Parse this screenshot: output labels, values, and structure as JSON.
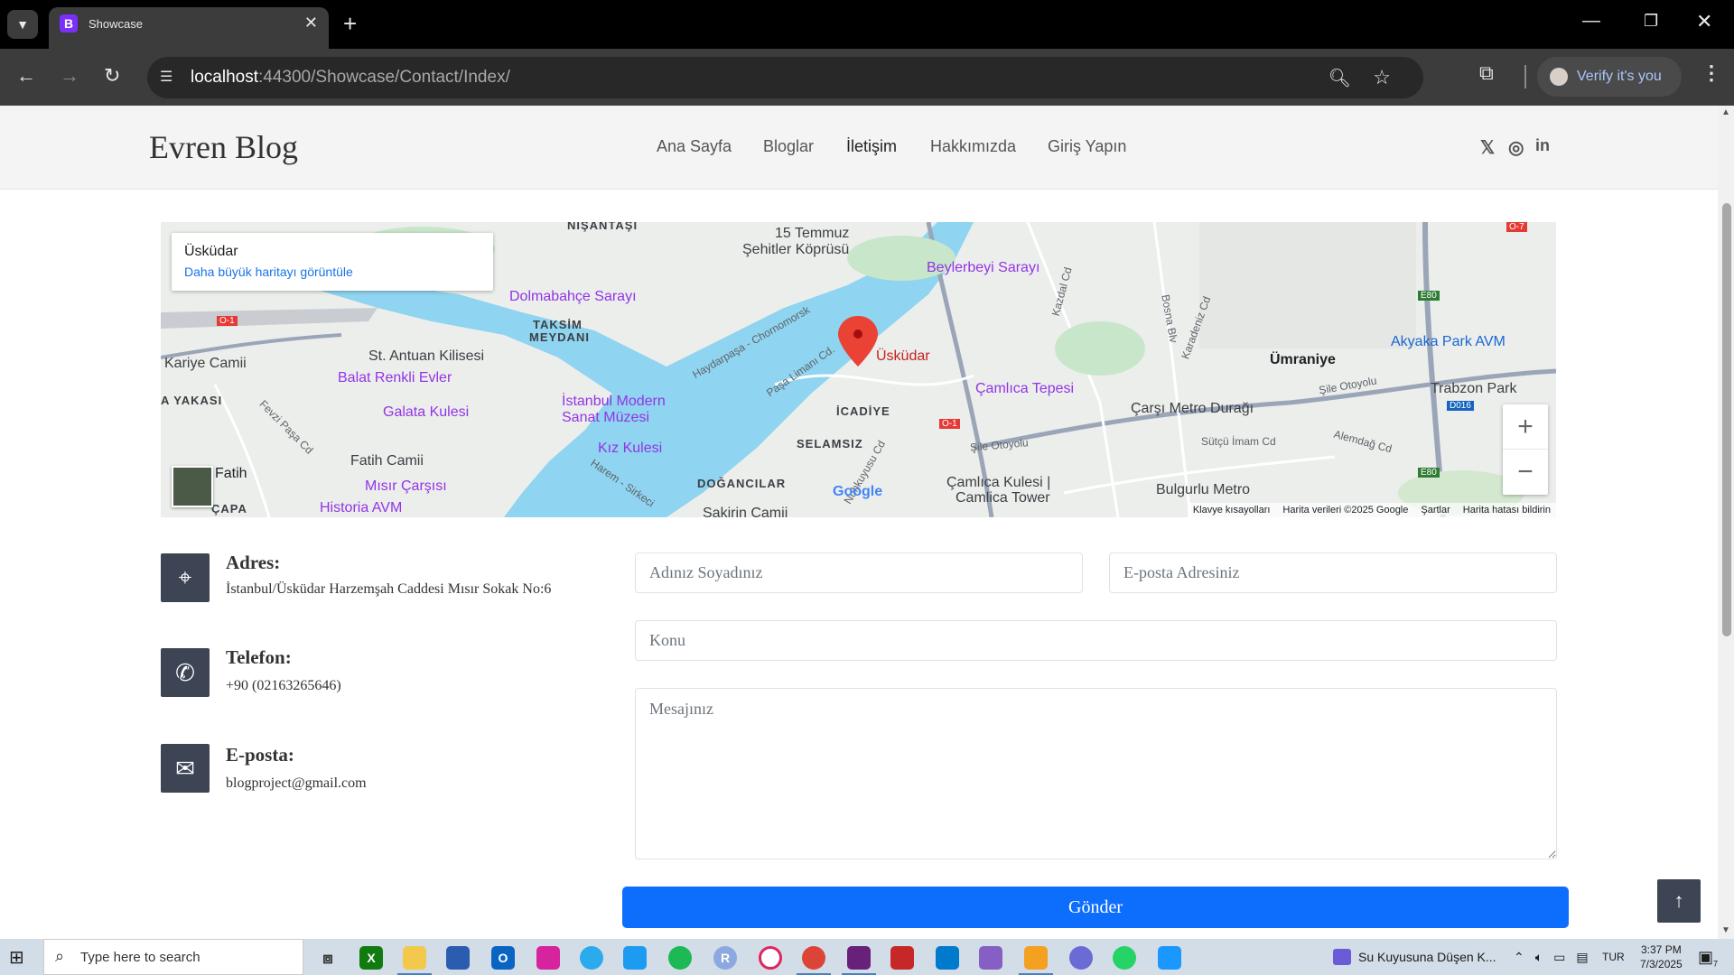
{
  "browser": {
    "tab_title": "Showcase",
    "tab_favicon_letter": "B",
    "url_host": "localhost",
    "url_path": ":44300/Showcase/Contact/Index/",
    "verify_label": "Verify it's you"
  },
  "site": {
    "brand": "Evren Blog",
    "nav": [
      {
        "label": "Ana Sayfa"
      },
      {
        "label": "Bloglar"
      },
      {
        "label": "İletişim"
      },
      {
        "label": "Hakkımızda"
      },
      {
        "label": "Giriş Yapın"
      }
    ],
    "active_nav": "İletişim",
    "social_icons": [
      "x-icon",
      "instagram-icon",
      "linkedin-icon"
    ]
  },
  "map": {
    "place_title": "Üsküdar",
    "bigger_map_link": "Daha büyük haritayı görüntüle",
    "marker_label": "Üsküdar",
    "labels": {
      "nisantasi": "NİŞANTAŞI",
      "temmuz": "15 Temmuz",
      "sehitler": "Şehitler Köprüsü",
      "beylerbeyi": "Beylerbeyi Sarayı",
      "dolmabahce": "Dolmabahçe Sarayı",
      "taksim1": "TAKSİM",
      "taksim2": "MEYDANI",
      "kariye": "Kariye Camii",
      "antuan": "St. Antuan Kilisesi",
      "balat": "Balat Renkli Evler",
      "galata": "Galata Kulesi",
      "modern1": "İstanbul Modern",
      "modern2": "Sanat Müzesi",
      "yakasi": "A YAKASI",
      "fevzi": "Fevzi Paşa Cd",
      "kiz": "Kız Kulesi",
      "fatih_camii": "Fatih Camii",
      "fatih": "Fatih",
      "misir": "Mısır Çarşısı",
      "capa": "ÇAPA",
      "historia": "Historia AVM",
      "icadiye": "İCADİYE",
      "selamsiz": "SELAMSIZ",
      "dogancilar": "DOĞANCILAR",
      "sakirin": "Şakirin Camii",
      "pasa_limani": "Paşa Limanı Cd.",
      "haydarpasa": "Haydarpaşa - Chornomorsk",
      "harem": "Harem - Sirkeci",
      "nuhkuyusu": "Nuhkuyusu Cd",
      "camlica_tepesi": "Çamlıca Tepesi",
      "camlica_kulesi1": "Çamlıca Kulesi |",
      "camlica_kulesi2": "Camlica Tower",
      "carsi_metro": "Çarşı Metro Durağı",
      "sutcu": "Sütçü İmam Cd",
      "bulgurlu": "Bulgurlu Metro",
      "umraniye": "Ümraniye",
      "akyaka": "Akyaka Park AVM",
      "trabzon": "Trabzon Park",
      "sile1": "Şile Otoyolu",
      "sile2": "Şile Otoyolu",
      "alemdag": "Alemdağ Cd",
      "kazdal": "Kazdal Cd",
      "bosna": "Bosna Blv",
      "karadeniz": "Karadeniz Cd",
      "o1a": "O-1",
      "o1b": "O-1",
      "o7": "O-7",
      "e80a": "E80",
      "e80b": "E80",
      "d016": "D016"
    },
    "google": "Google",
    "footer": [
      "Klavye kısayolları",
      "Harita verileri ©2025 Google",
      "Şartlar",
      "Harita hatası bildirin"
    ]
  },
  "contact": {
    "address_title": "Adres:",
    "address_text": "İstanbul/Üsküdar Harzemşah Caddesi Mısır Sokak No:6",
    "phone_title": "Telefon:",
    "phone_text": "+90 (02163265646)",
    "email_title": "E-posta:",
    "email_text": "blogproject@gmail.com"
  },
  "form": {
    "name_placeholder": "Adınız Soyadınız",
    "email_placeholder": "E-posta Adresiniz",
    "subject_placeholder": "Konu",
    "message_placeholder": "Mesajınız",
    "submit_label": "Gönder"
  },
  "taskbar": {
    "search_placeholder": "Type here to search",
    "media_title": "Su Kuyusuna Düşen K...",
    "language": "TUR",
    "time": "3:37 PM",
    "date": "7/3/2025",
    "notification_count": "7"
  },
  "colors": {
    "accent_button": "#0d6efd",
    "icon_box": "#3d4454",
    "water": "#8fd4f0"
  }
}
